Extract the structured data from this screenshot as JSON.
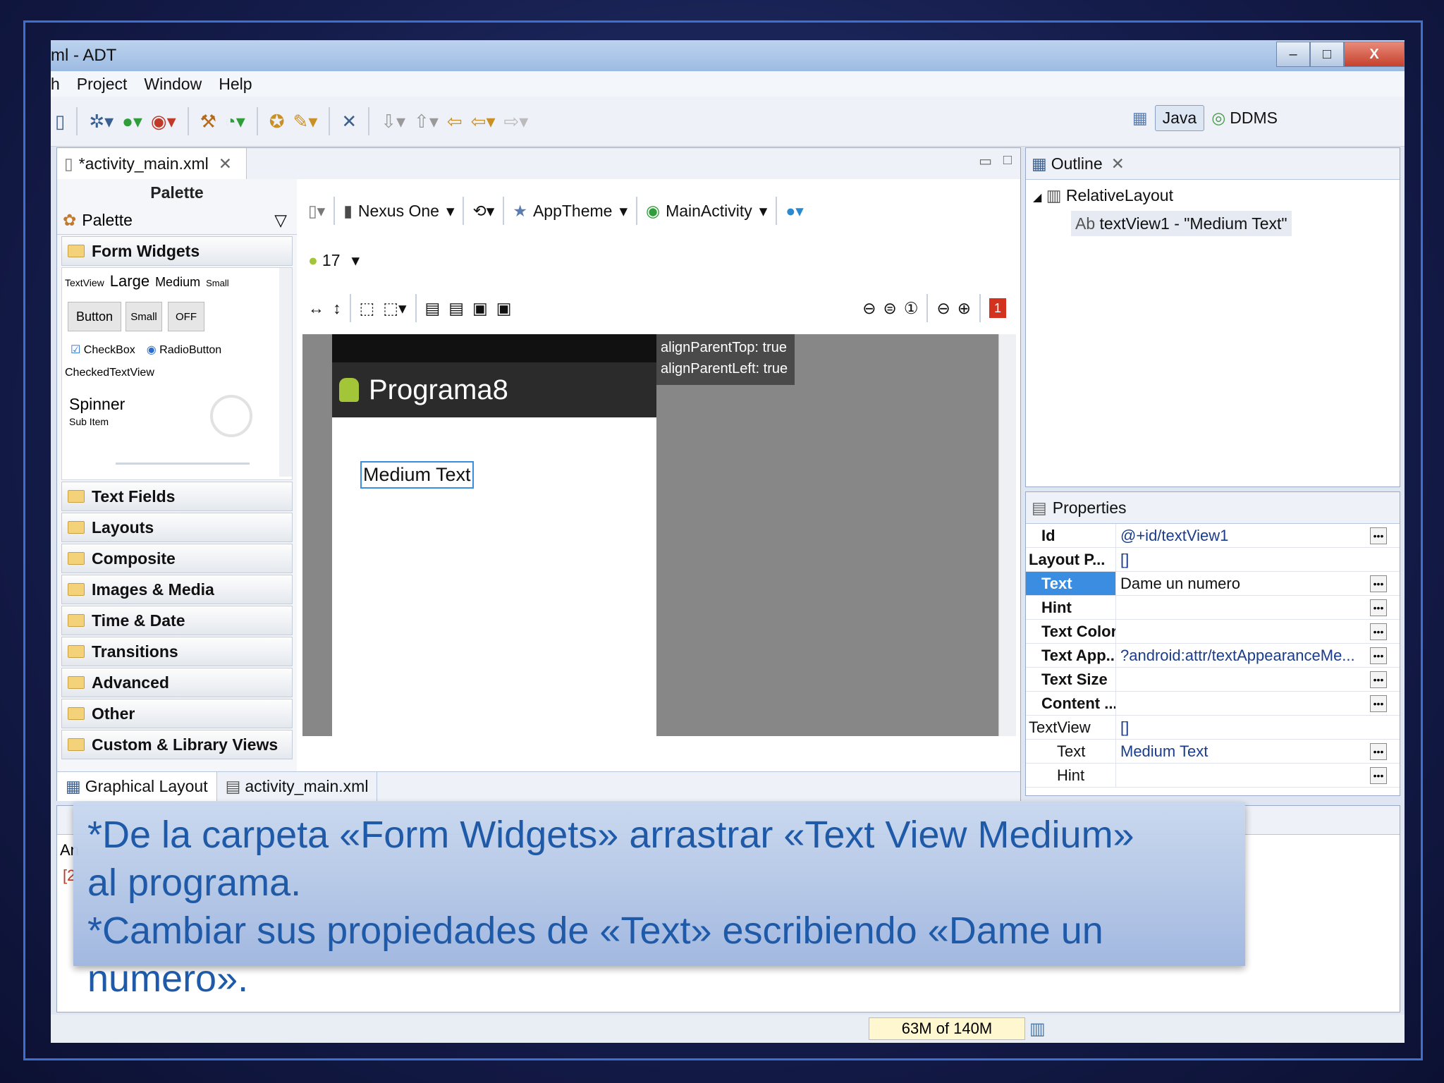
{
  "window": {
    "title": "ml - ADT",
    "btn_min": "–",
    "btn_max": "□",
    "btn_close": "X"
  },
  "menu": [
    "h",
    "Project",
    "Window",
    "Help"
  ],
  "perspectives": {
    "java": "Java",
    "ddms": "DDMS"
  },
  "editor": {
    "tab": "*activity_main.xml",
    "palette_title": "Palette",
    "palette_dropdown": "Palette",
    "form_widgets": "Form Widgets",
    "textview_sizes": [
      "TextView",
      "Large",
      "Medium",
      "Small"
    ],
    "widget_buttons": [
      "Button",
      "Small",
      "OFF"
    ],
    "checkbox": "CheckBox",
    "radiobutton": "RadioButton",
    "checkedtextview": "CheckedTextView",
    "spinner": "Spinner",
    "spinner_sub": "Sub Item",
    "categories": [
      "Text Fields",
      "Layouts",
      "Composite",
      "Images & Media",
      "Time & Date",
      "Transitions",
      "Advanced",
      "Other",
      "Custom & Library Views"
    ],
    "device": "Nexus One",
    "theme": "AppTheme",
    "activity": "MainActivity",
    "api_level": "17",
    "error_badge": "1",
    "app_title": "Programa8",
    "tooltip_line1": "alignParentTop: true",
    "tooltip_line2": "alignParentLeft: true",
    "widget_text": "Medium Text",
    "bottom_tabs": [
      "Graphical Layout",
      "activity_main.xml"
    ]
  },
  "outline": {
    "title": "Outline",
    "root": "RelativeLayout",
    "child": "textView1 - \"Medium Text\""
  },
  "properties": {
    "title": "Properties",
    "rows": [
      {
        "key": "Id",
        "value": "@+id/textView1"
      },
      {
        "key": "Layout P...",
        "value": "[]"
      },
      {
        "key": "Text",
        "value": "Dame un numero"
      },
      {
        "key": "Hint",
        "value": ""
      },
      {
        "key": "Text Color",
        "value": ""
      },
      {
        "key": "Text App...",
        "value": "?android:attr/textAppearanceMe..."
      },
      {
        "key": "Text Size",
        "value": ""
      },
      {
        "key": "Content ...",
        "value": ""
      },
      {
        "key": "TextView",
        "value": "[]"
      },
      {
        "key": "Text",
        "value": "Medium Text"
      },
      {
        "key": "Hint",
        "value": ""
      }
    ]
  },
  "console": {
    "label1": "An",
    "label2": "[2"
  },
  "status": {
    "memory": "63M of 140M"
  },
  "overlay": {
    "line1": "*De la carpeta «Form Widgets» arrastrar «Text View Medium»",
    "line2": "al programa.",
    "line3": "*Cambiar sus propiedades de «Text» escribiendo «Dame un",
    "line4": "numero»."
  },
  "colors": {
    "frame": "#3d6fd0",
    "overlay_text": "#1f5aa8",
    "selection": "#3a8de0"
  }
}
